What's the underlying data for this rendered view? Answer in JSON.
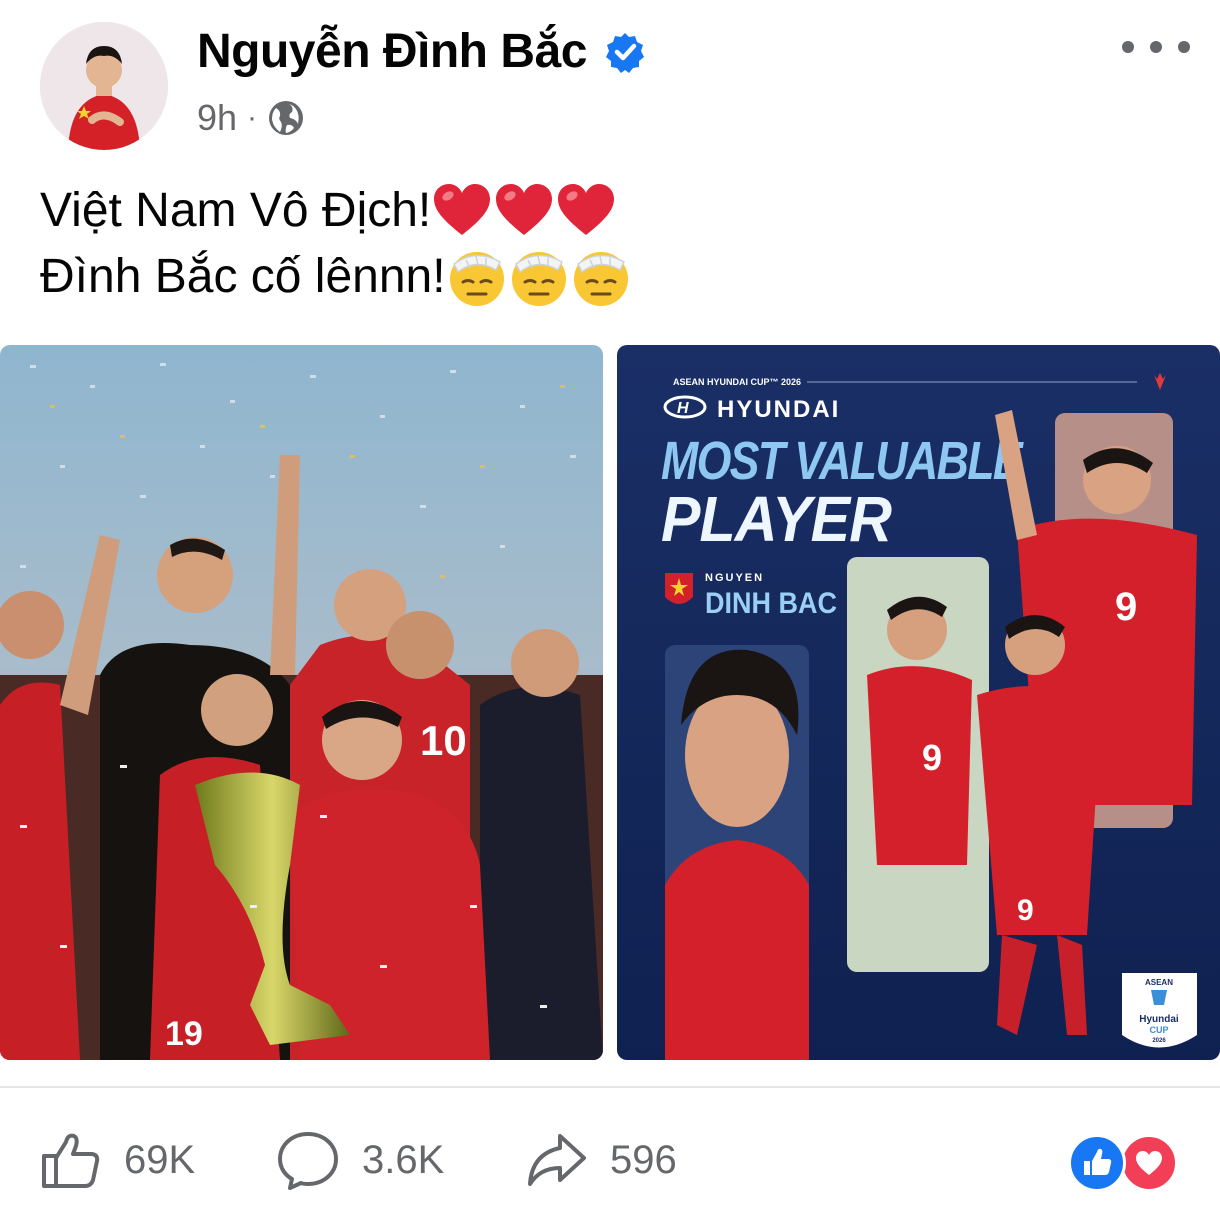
{
  "post": {
    "author": "Nguyễn Đình Bắc",
    "verified": true,
    "timestamp": "9h",
    "audience_icon": "globe-icon",
    "more_icon": "more-options-icon",
    "text_line1": "Việt Nam Vô Địch!",
    "text_line1_emoji": [
      "red-heart-emoji",
      "red-heart-emoji",
      "red-heart-emoji"
    ],
    "text_line2": "Đình Bắc cố lênnn!",
    "text_line2_emoji": [
      "face-with-bandage-emoji",
      "face-with-bandage-emoji",
      "face-with-bandage-emoji"
    ]
  },
  "photo2": {
    "tournament": "ASEAN HYUNDAI CUP™ 2026",
    "sponsor": "HYUNDAI",
    "title_line1": "MOST VALUABLE",
    "title_line2": "PLAYER",
    "player_first": "NGUYEN",
    "player_last": "DINH BAC",
    "jersey_number": "9",
    "badge_line1": "ASEAN",
    "badge_line2": "Hyundai",
    "badge_line3": "CUP",
    "badge_year": "2026"
  },
  "photo1": {
    "jersey_a": "10",
    "jersey_b": "19"
  },
  "actions": {
    "likes": "69K",
    "comments": "3.6K",
    "shares": "596"
  },
  "colors": {
    "verified": "#1877f2",
    "secondary_text": "#65676b",
    "mvp_bg": "#14285a",
    "title_blue": "#8ec8f0",
    "jersey_red": "#d4202a"
  }
}
